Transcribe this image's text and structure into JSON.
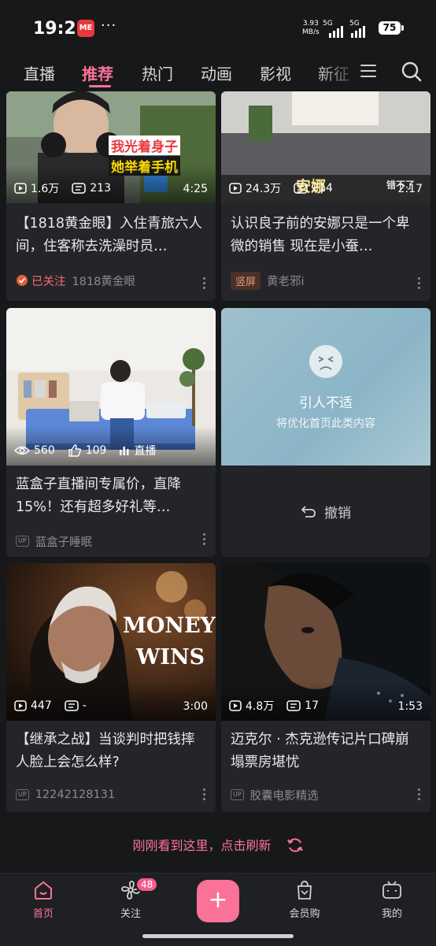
{
  "status": {
    "time": "19:25",
    "app_badge": "ME",
    "dots": "···",
    "net_speed_value": "3.93",
    "net_speed_unit": "MB/s",
    "sim1": "5G",
    "sim2": "5G",
    "battery": "75"
  },
  "tabs": [
    "直播",
    "推荐",
    "热门",
    "动画",
    "影视",
    "新征"
  ],
  "active_tab": "推荐",
  "cards": [
    {
      "views": "1.6万",
      "danmaku": "213",
      "duration": "4:25",
      "title": "【1818黄金眼】入住青旅六人间，住客称去洗澡时员…",
      "follow": "已关注",
      "author": "1818黄金眼",
      "overlay_line1": "我光着身子",
      "overlay_line2": "她举着手机"
    },
    {
      "views": "24.3万",
      "danmaku": "214",
      "duration": "2:17",
      "title": "认识良子前的安娜只是一个卑微的销售 现在是小蚕…",
      "tag": "竖屏",
      "author": "黄老邪i",
      "overlay_text": "安娜",
      "overlay_text2": "错不了"
    },
    {
      "views": "560",
      "likes": "109",
      "live_label": "直播",
      "title": "蓝盒子直播间专属价，直降15%！还有超多好礼等…",
      "up_tag": "UP",
      "author": "蓝盒子睡眠"
    },
    {
      "feedback_title": "引人不适",
      "feedback_sub": "将优化首页此类内容",
      "undo": "撤销"
    },
    {
      "views": "447",
      "danmaku": "-",
      "duration": "3:00",
      "title": "【继承之战】当谈判时把钱摔人脸上会怎么样?",
      "up_tag": "UP",
      "author": "12242128131",
      "overlay_line1": "MONEY",
      "overlay_line2": "WINS"
    },
    {
      "views": "4.8万",
      "danmaku": "17",
      "duration": "1:53",
      "title": "迈克尔 · 杰克逊传记片口碑崩塌票房堪忧",
      "up_tag": "UP",
      "author": "胶囊电影精选"
    }
  ],
  "refresh_text": "刚刚看到这里，点击刷新",
  "bottom_nav": {
    "home": "首页",
    "follow": "关注",
    "follow_badge": "48",
    "plus": "+",
    "vip_shop": "会员购",
    "mine": "我的"
  },
  "colors": {
    "accent": "#fb7299",
    "background": "#17181a",
    "card": "#242528"
  },
  "icons": [
    "search-icon",
    "menu-icon",
    "play-icon",
    "danmaku-icon",
    "eye-icon",
    "thumbs-up-icon",
    "live-bars-icon",
    "undo-icon",
    "refresh-icon",
    "home-icon",
    "fan-icon",
    "shopping-bag-icon",
    "tv-icon"
  ]
}
